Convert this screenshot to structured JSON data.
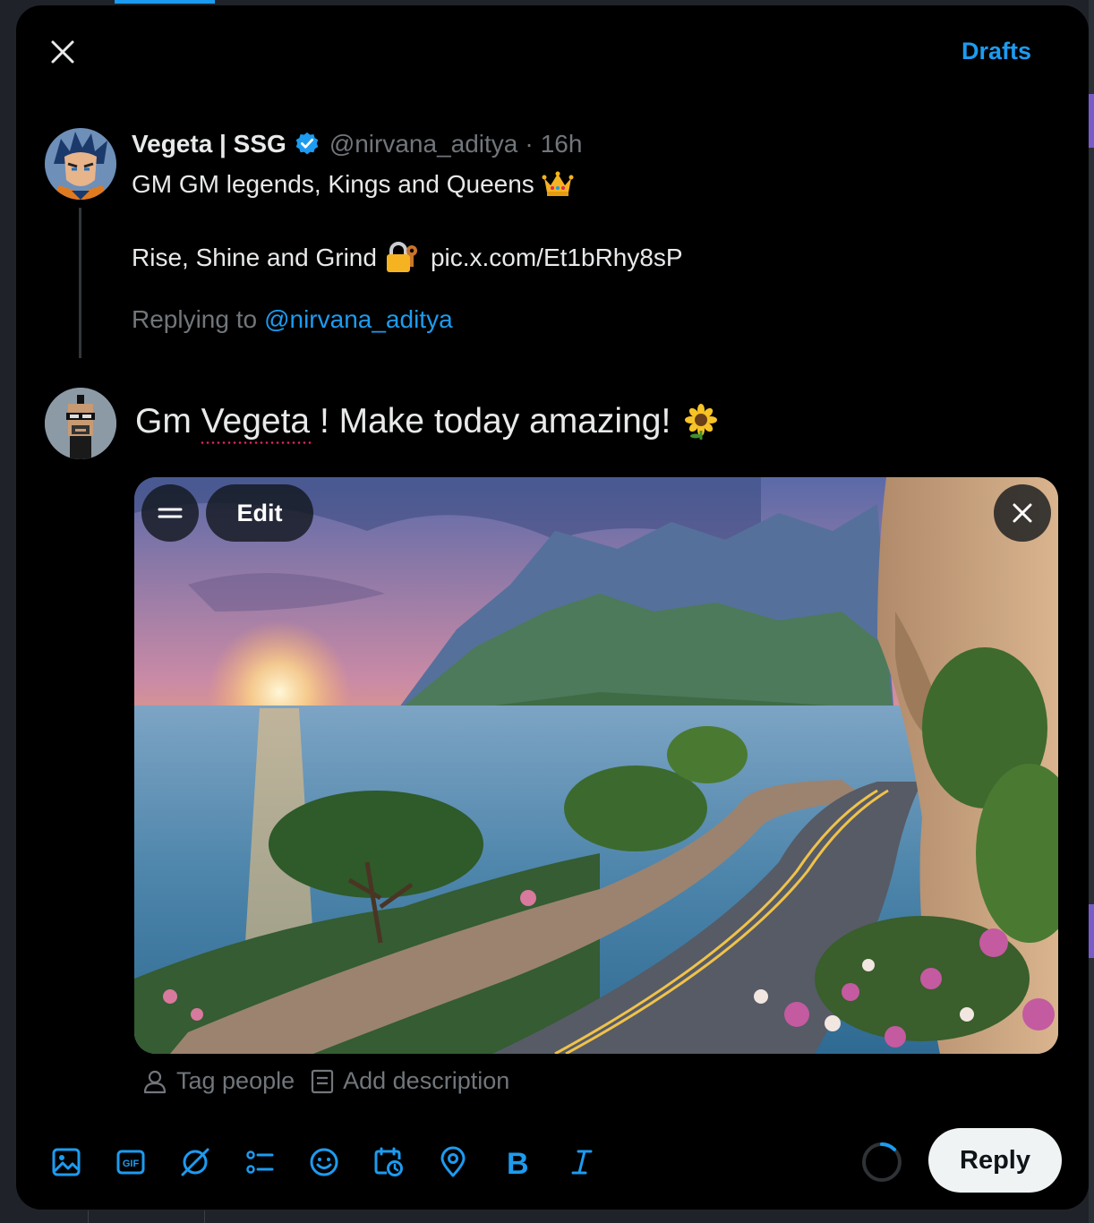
{
  "header": {
    "drafts_label": "Drafts"
  },
  "quoted_tweet": {
    "author_name": "Vegeta | SSG",
    "handle": "@nirvana_aditya",
    "separator": "·",
    "time": "16h",
    "line1": "GM GM legends, Kings and Queens",
    "line2_text": "Rise, Shine and Grind",
    "line2_link": "pic.x.com/Et1bRhy8sP",
    "replying_prefix": "Replying to",
    "replying_handle": "@nirvana_aditya"
  },
  "compose": {
    "text": "Gm Vegeta !  Make today amazing!"
  },
  "media": {
    "edit_label": "Edit",
    "tag_people_label": "Tag people",
    "add_description_label": "Add description"
  },
  "toolbar": {
    "tools": [
      "image-icon",
      "gif-icon",
      "grok-icon",
      "poll-icon",
      "emoji-icon",
      "schedule-icon",
      "location-icon",
      "bold-icon",
      "italic-icon"
    ],
    "reply_label": "Reply"
  },
  "colors": {
    "accent": "#1d9bf0",
    "background": "#000000",
    "muted_text": "#71767b",
    "primary_text": "#e7e9ea"
  }
}
